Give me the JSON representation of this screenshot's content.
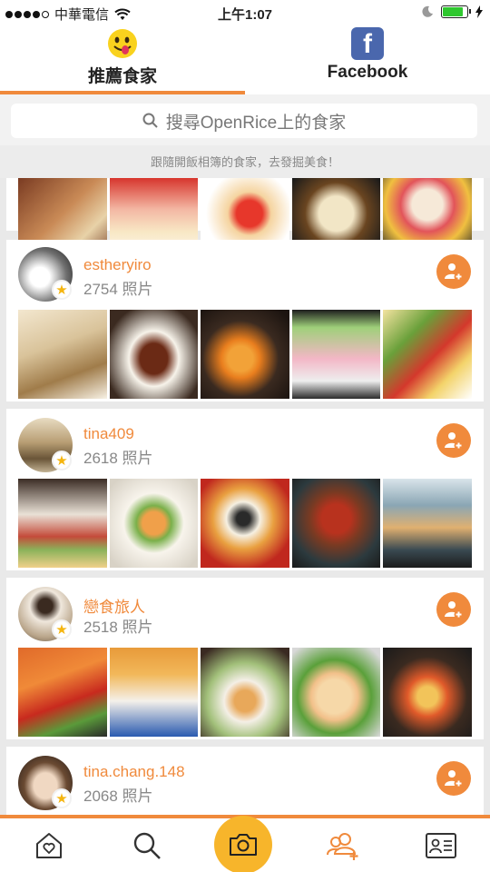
{
  "status_bar": {
    "carrier": "中華電信",
    "time": "上午1:07",
    "signal_bars": 4,
    "battery_level": 0.85
  },
  "tabs": [
    {
      "label": "推薦食家",
      "icon": "emoji-tongue-icon",
      "active": true
    },
    {
      "label": "Facebook",
      "icon": "facebook-logo-icon",
      "active": false
    }
  ],
  "search": {
    "placeholder": "搜尋OpenRice上的食家",
    "icon": "search-icon"
  },
  "hint_text": "跟隨開飯相簿的食家，去發掘美食！",
  "users": [
    {
      "name": "estheryiro",
      "count": "2754 照片"
    },
    {
      "name": "tina409",
      "count": "2618 照片"
    },
    {
      "name": "戀食旅人",
      "count": "2518 照片"
    },
    {
      "name": "tina.chang.148",
      "count": "2068 照片"
    }
  ],
  "colors": {
    "accent": "#f08a3c",
    "camera": "#f7b52b",
    "star": "#f5b50f",
    "facebook": "#4a67ad"
  },
  "bottom_nav": [
    {
      "icon": "home-heart-icon"
    },
    {
      "icon": "search-icon"
    },
    {
      "icon": "camera-icon"
    },
    {
      "icon": "add-user-icon"
    },
    {
      "icon": "profile-card-icon"
    }
  ]
}
